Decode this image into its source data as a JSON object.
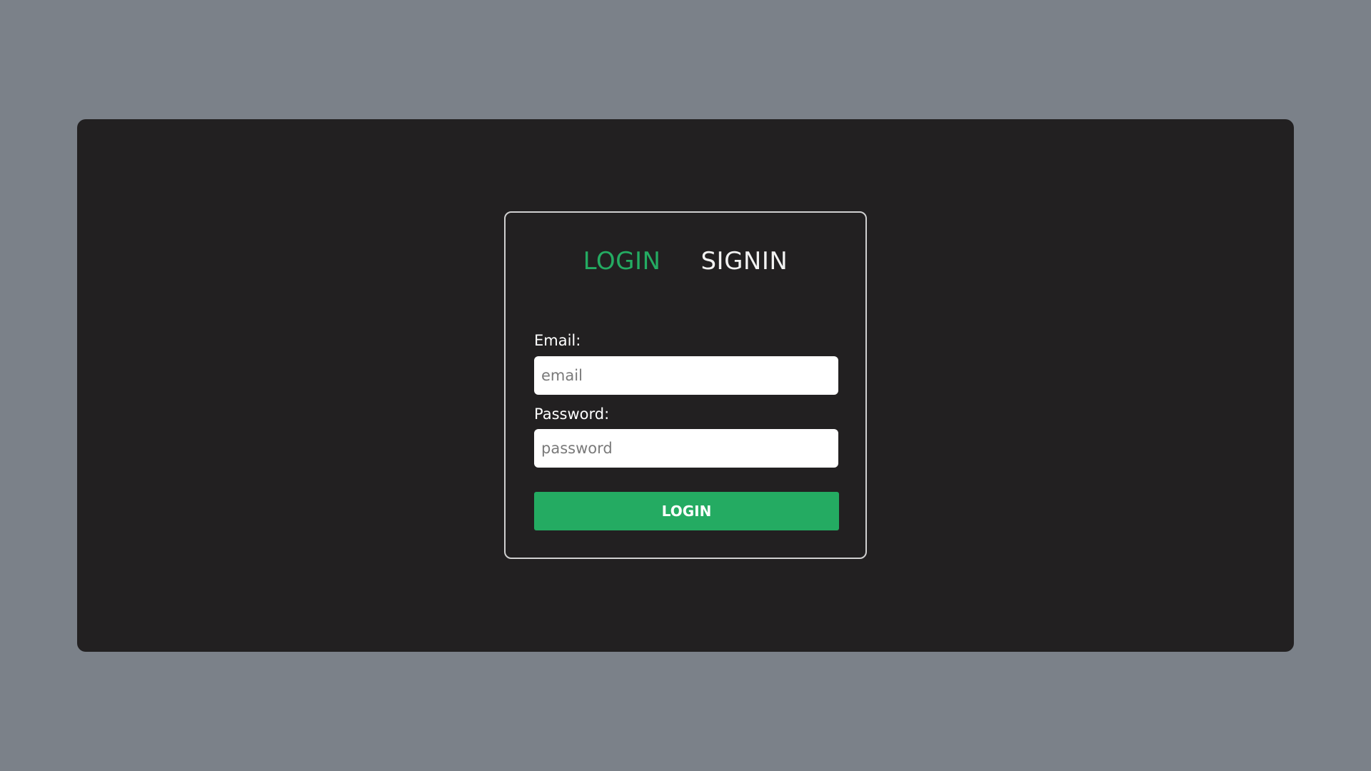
{
  "colors": {
    "background": "#7b8189",
    "panel": "#222021",
    "accent": "#24ab62",
    "text": "#ffffff"
  },
  "tabs": [
    {
      "label": "LOGIN",
      "active": true
    },
    {
      "label": "SIGNIN",
      "active": false
    }
  ],
  "form": {
    "email": {
      "label": "Email:",
      "placeholder": "email",
      "value": ""
    },
    "password": {
      "label": "Password:",
      "placeholder": "password",
      "value": ""
    },
    "submit_label": "LOGIN"
  }
}
